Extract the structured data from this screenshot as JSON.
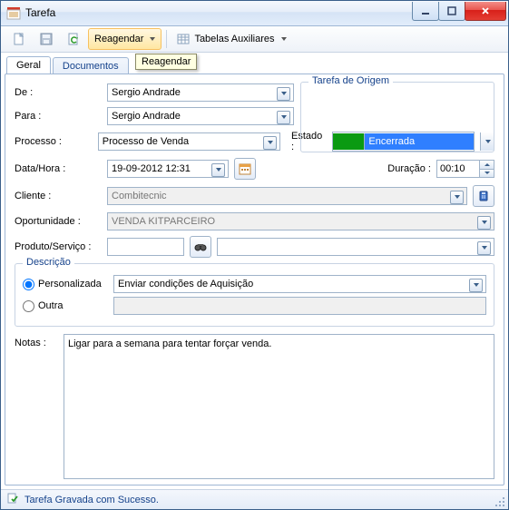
{
  "window": {
    "title": "Tarefa"
  },
  "toolbar": {
    "reagendar": "Reagendar",
    "tabelas": "Tabelas Auxiliares",
    "tooltip": "Reagendar"
  },
  "tabs": {
    "geral": "Geral",
    "documentos": "Documentos"
  },
  "labels": {
    "de": "De :",
    "para": "Para :",
    "processo": "Processo :",
    "estado": "Estado :",
    "datahora": "Data/Hora :",
    "duracao": "Duração :",
    "cliente": "Cliente :",
    "oportunidade": "Oportunidade :",
    "produto": "Produto/Serviço :",
    "descricao": "Descrição",
    "personalizada": "Personalizada",
    "outra": "Outra",
    "notas": "Notas :",
    "origem": "Tarefa de Origem"
  },
  "values": {
    "de": "Sergio Andrade",
    "para": "Sergio Andrade",
    "processo": "Processo de Venda",
    "estado": "Encerrada",
    "datahora": "19-09-2012 12:31",
    "duracao": "00:10",
    "cliente": "Combitecnic",
    "oportunidade": "VENDA KITPARCEIRO",
    "desc_personalizada": "Enviar condições de Aquisição",
    "notas": "Ligar para a semana para tentar forçar venda."
  },
  "status": {
    "message": "Tarefa Gravada com Sucesso."
  }
}
